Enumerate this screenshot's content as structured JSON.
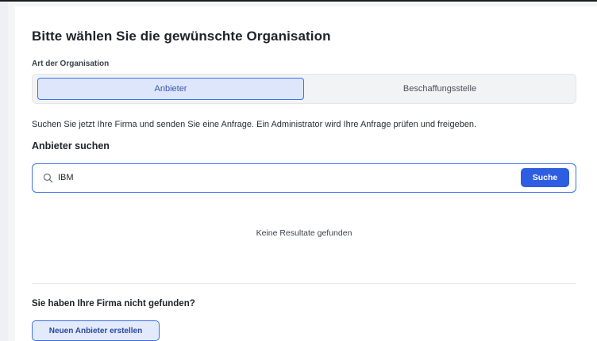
{
  "page": {
    "title": "Bitte wählen Sie die gewünschte Organisation"
  },
  "organization_type": {
    "label": "Art der Organisation",
    "options": [
      "Anbieter",
      "Beschaffungsstelle"
    ],
    "selected": "Anbieter"
  },
  "info": {
    "text": "Suchen Sie jetzt Ihre Firma und senden Sie eine Anfrage. Ein Administrator wird Ihre Anfrage prüfen und freigeben."
  },
  "search": {
    "heading": "Anbieter suchen",
    "value": "IBM",
    "button_label": "Suche",
    "icon": "search-icon"
  },
  "results": {
    "empty_text": "Keine Resultate gefunden"
  },
  "footer": {
    "heading": "Sie haben Ihre Firma nicht gefunden?",
    "create_button_label": "Neuen Anbieter erstellen"
  },
  "colors": {
    "accent": "#2d5de0",
    "accent_border": "#3d6fe8",
    "selected_bg": "#dde6fb"
  }
}
